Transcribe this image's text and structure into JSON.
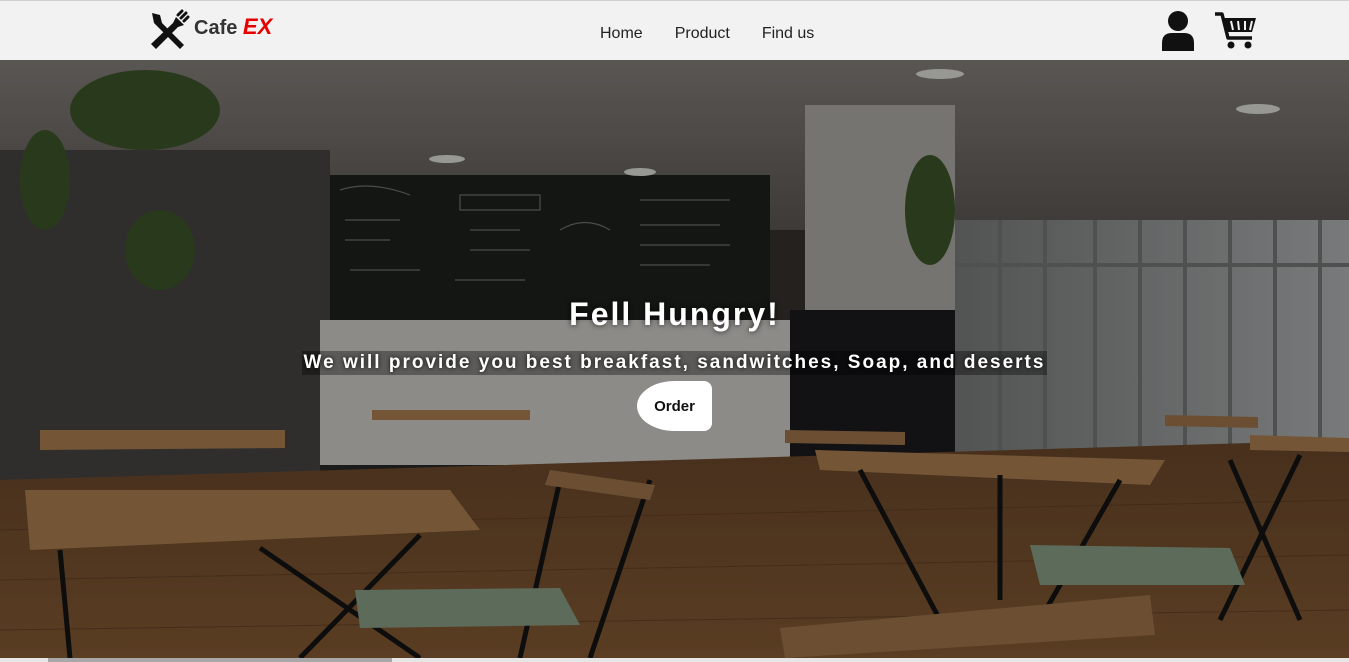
{
  "nav": {
    "brand_main": "Cafe",
    "brand_accent": "EX",
    "links": [
      {
        "label": "Home"
      },
      {
        "label": "Product"
      },
      {
        "label": "Find us"
      }
    ],
    "icons": [
      "user-icon",
      "cart-icon"
    ]
  },
  "hero": {
    "title": "Fell Hungry!",
    "subtitle": "We will provide you best breakfast, sandwitches, Soap, and deserts",
    "button_label": "Order"
  },
  "colors": {
    "navbar_bg": "#f2f2f2",
    "brand_accent": "#e60000",
    "text_dark": "#222222",
    "hero_text": "#ffffff"
  }
}
